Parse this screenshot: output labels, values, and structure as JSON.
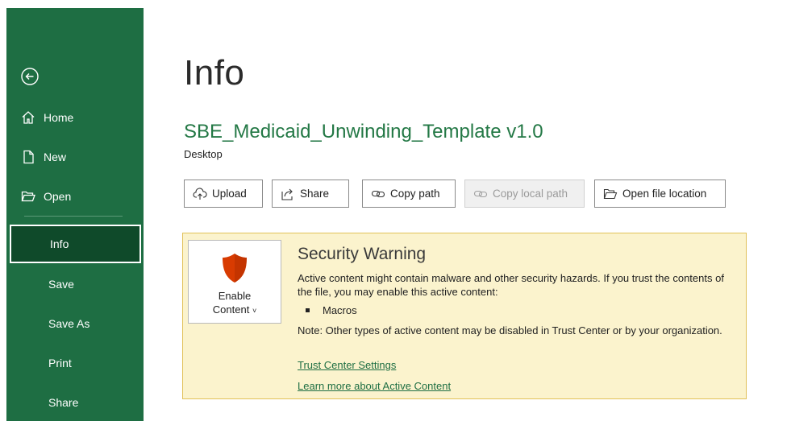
{
  "sidebar": {
    "back_icon": "back-arrow-circle-icon",
    "items": [
      {
        "label": "Home",
        "icon": "home-icon"
      },
      {
        "label": "New",
        "icon": "new-document-icon"
      },
      {
        "label": "Open",
        "icon": "open-folder-icon"
      },
      {
        "label": "Info"
      },
      {
        "label": "Save"
      },
      {
        "label": "Save As"
      },
      {
        "label": "Print"
      },
      {
        "label": "Share"
      }
    ],
    "active": "Info",
    "colors": {
      "background": "#1e6e43",
      "active": "#0f4a2a"
    }
  },
  "main": {
    "title": "Info",
    "filename": "SBE_Medicaid_Unwinding_Template v1.0",
    "location": "Desktop",
    "actions": [
      {
        "label": "Upload",
        "icon": "upload-cloud-icon",
        "enabled": true
      },
      {
        "label": "Share",
        "icon": "share-icon",
        "enabled": true
      },
      {
        "label": "Copy path",
        "icon": "link-icon",
        "enabled": true
      },
      {
        "label": "Copy local path",
        "icon": "link-icon",
        "enabled": false
      },
      {
        "label": "Open file location",
        "icon": "folder-open-icon",
        "enabled": true
      }
    ]
  },
  "security_warning": {
    "enable_button_line1": "Enable",
    "enable_button_line2": "Content",
    "enable_icon": "shield-icon",
    "title": "Security Warning",
    "text": "Active content might contain malware and other security hazards. If you trust the contents of the file, you may enable this active content:",
    "bullet": "Macros",
    "note": "Note: Other types of active content may be disabled in Trust Center or by your organization.",
    "link1": "Trust Center Settings",
    "link2": "Learn more about Active Content",
    "colors": {
      "background": "#fbf3cd",
      "border": "#e1c159",
      "shield": "#d83b01"
    }
  }
}
